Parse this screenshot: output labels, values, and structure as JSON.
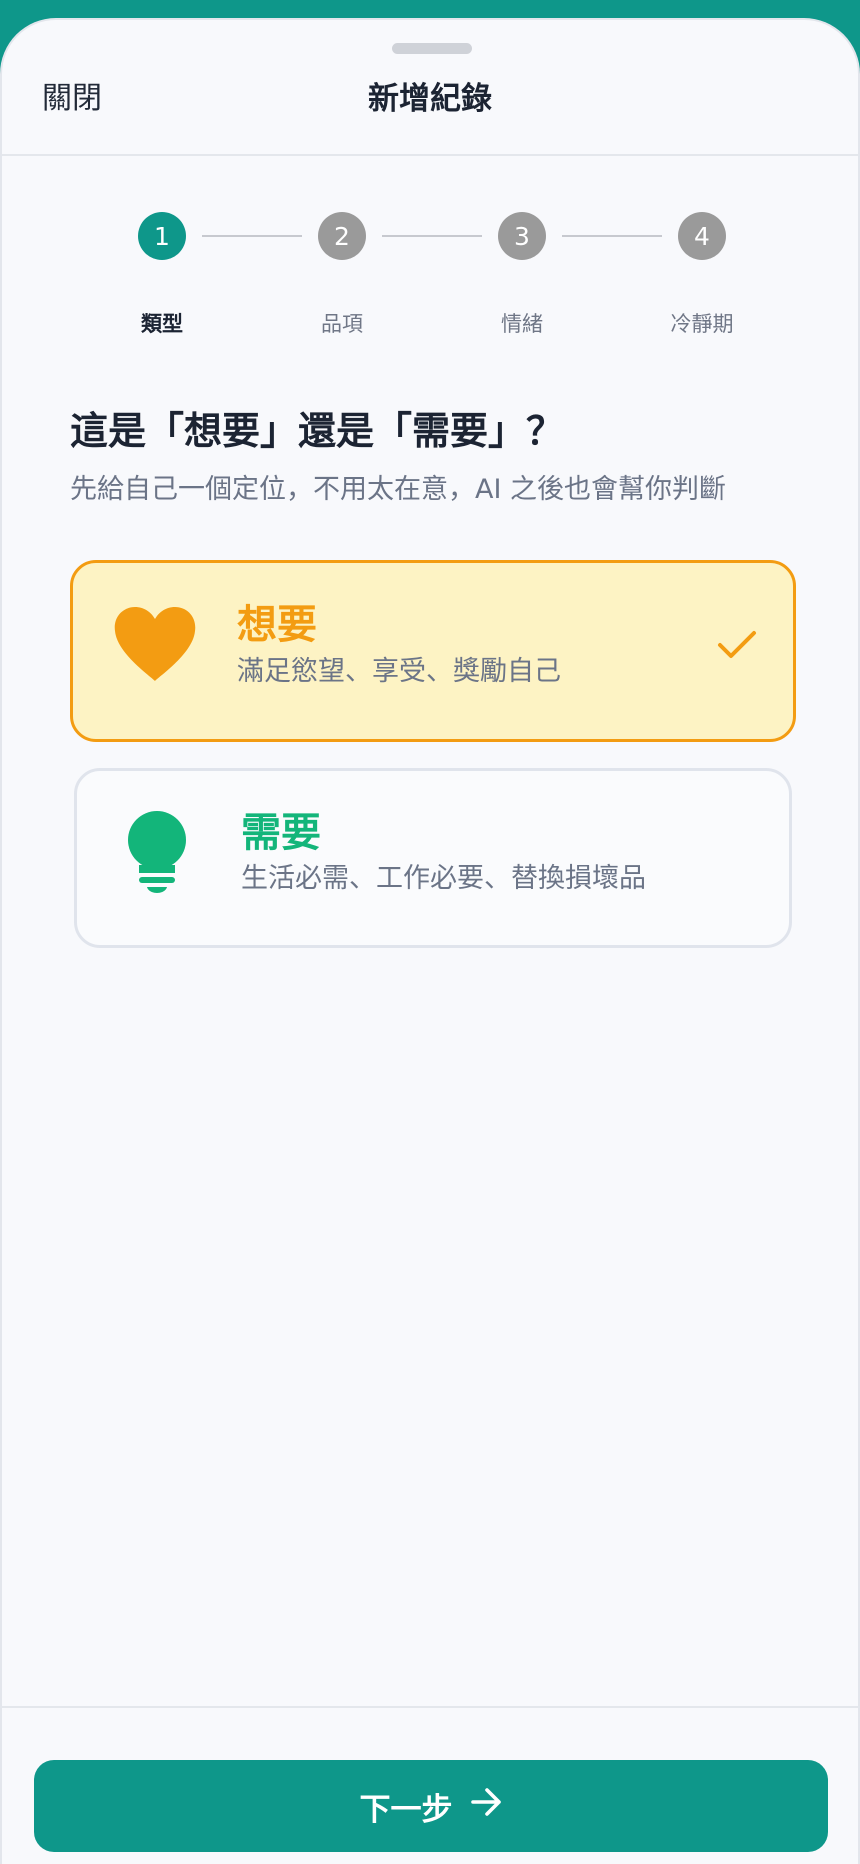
{
  "header": {
    "close_label": "關閉",
    "title": "新增紀錄"
  },
  "stepper": {
    "steps": [
      {
        "number": "1",
        "label": "類型",
        "active": true
      },
      {
        "number": "2",
        "label": "品項",
        "active": false
      },
      {
        "number": "3",
        "label": "情緒",
        "active": false
      },
      {
        "number": "4",
        "label": "冷靜期",
        "active": false
      }
    ]
  },
  "main": {
    "question": "這是「想要」還是「需要」？",
    "hint": "先給自己一個定位，不用太在意，AI 之後也會幫你判斷",
    "options": [
      {
        "title": "想要",
        "description": "滿足慾望、享受、獎勵自己",
        "icon": "heart-icon",
        "selected": true,
        "color": "#f39c12"
      },
      {
        "title": "需要",
        "description": "生活必需、工作必要、替換損壞品",
        "icon": "lightbulb-icon",
        "selected": false,
        "color": "#13b57a"
      }
    ]
  },
  "footer": {
    "next_label": "下一步",
    "next_icon": "arrow-right-icon"
  },
  "colors": {
    "primary": "#0e978a",
    "want": "#f39c12",
    "need": "#13b57a"
  }
}
